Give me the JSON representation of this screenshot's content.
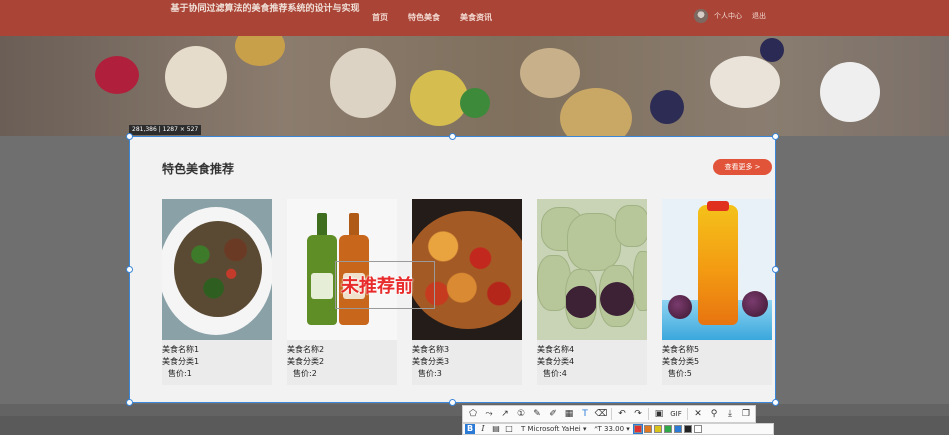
{
  "site": {
    "title": "基于协同过滤算法的美食推荐系统的设计与实现",
    "nav": [
      "首页",
      "特色美食",
      "美食资讯"
    ],
    "user_links": [
      "个人中心",
      "退出"
    ]
  },
  "capture": {
    "dimension_label": "281,386 | 1287 × 527"
  },
  "section": {
    "title": "特色美食推荐",
    "more_button": "查看更多 >"
  },
  "cards": [
    {
      "name": "美食名称1",
      "category": "美食分类1",
      "price": "售价:1",
      "image_icon": "stir-fry-dish-image"
    },
    {
      "name": "美食名称2",
      "category": "美食分类2",
      "price": "售价:2",
      "image_icon": "juice-bottles-image"
    },
    {
      "name": "美食名称3",
      "category": "美食分类3",
      "price": "售价:3",
      "image_icon": "spicy-chicken-image"
    },
    {
      "name": "美食名称4",
      "category": "美食分类4",
      "price": "售价:4",
      "image_icon": "mochi-image"
    },
    {
      "name": "美食名称5",
      "category": "美食分类5",
      "price": "售价:5",
      "image_icon": "fruit-tea-drink-image"
    }
  ],
  "annotation": {
    "text": "未推荐前",
    "color": "#e82b2b"
  },
  "toolbar": {
    "gif_label": "GIF",
    "bold_label": "B",
    "italic_label": "I",
    "font_name": "Microsoft YaHei",
    "font_size": "33.00",
    "colors": [
      "#e03030",
      "#e07a20",
      "#d9c21a",
      "#2fa84a",
      "#2a7ad6",
      "#222222",
      "#ffffff"
    ]
  },
  "colors": {
    "accent": "#e2543a",
    "header": "#a94436",
    "selection_border": "#3a86d8"
  }
}
